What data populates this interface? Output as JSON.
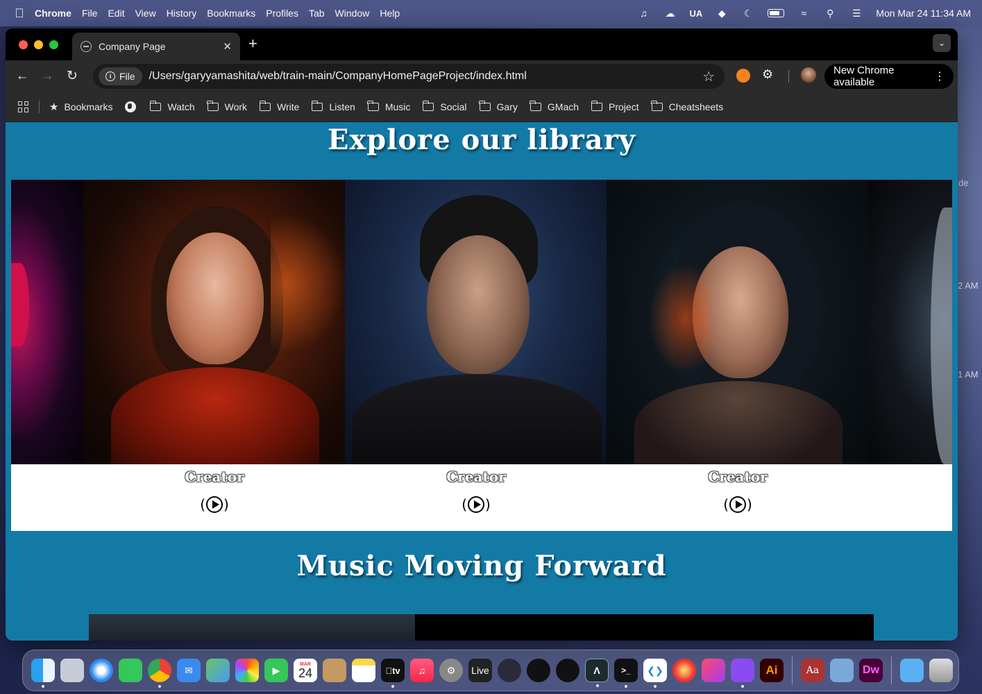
{
  "menubar": {
    "app_name": "Chrome",
    "menus": [
      "File",
      "Edit",
      "View",
      "History",
      "Bookmarks",
      "Profiles",
      "Tab",
      "Window",
      "Help"
    ],
    "input_source": "UA",
    "clock": "Mon Mar 24  11:34 AM"
  },
  "browser": {
    "tab_title": "Company Page",
    "omnibox": {
      "scheme_chip": "File",
      "url": "/Users/garyyamashita/web/train-main/CompanyHomePageProject/index.html"
    },
    "update_button": "New Chrome available",
    "bookmarks": {
      "all_label": "Bookmarks",
      "folders": [
        "Watch",
        "Work",
        "Write",
        "Listen",
        "Music",
        "Social",
        "Gary",
        "GMach",
        "Project",
        "Cheatsheets"
      ]
    }
  },
  "page": {
    "library_title": "Explore our library",
    "cards": [
      {
        "label": "Creator"
      },
      {
        "label": "Creator"
      },
      {
        "label": "Creator"
      }
    ],
    "music_title": "Music Moving Forward"
  },
  "desktop": {
    "side_text_1": "de",
    "side_text_2": "2 AM",
    "side_text_3": "1 AM"
  },
  "dock": {
    "calendar_month": "MAR",
    "calendar_day": "24",
    "tv_label": "tv",
    "live_label": "Live",
    "ai_label": "Ai",
    "dict_label": "Aa",
    "dw_label": "Dw"
  },
  "colors": {
    "page_bg": "#137aa6",
    "accent_orange": "#f58220"
  }
}
